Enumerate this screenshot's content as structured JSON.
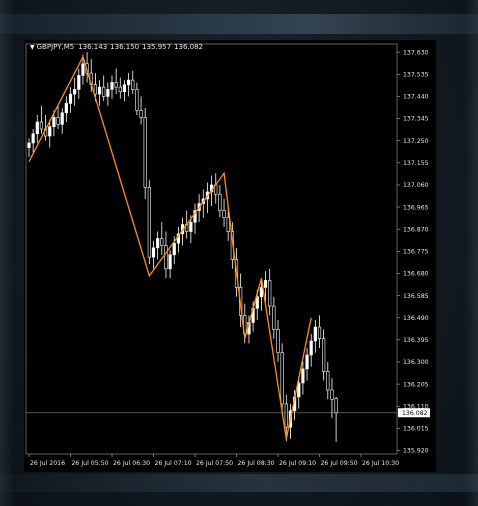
{
  "chart_header": {
    "symbol": "GBPJPY,M5",
    "open": "136.143",
    "high": "136.150",
    "low": "135.957",
    "close": "136.082"
  },
  "chart_data": {
    "type": "candlestick",
    "symbol": "GBPJPY",
    "timeframe": "M5",
    "ylim": [
      135.905,
      137.665
    ],
    "price_axis_labels": [
      "137.630",
      "137.535",
      "137.440",
      "137.345",
      "137.250",
      "137.155",
      "137.060",
      "136.965",
      "136.870",
      "136.775",
      "136.680",
      "136.585",
      "136.490",
      "136.395",
      "136.300",
      "136.205",
      "136.110",
      "136.015",
      "135.920"
    ],
    "current_price_label": "136.082",
    "current_price": 136.082,
    "time_axis_labels": [
      "26 Jul 2016",
      "26 Jul 05:50",
      "26 Jul 06:30",
      "26 Jul 07:10",
      "26 Jul 07:50",
      "26 Jul 08:30",
      "26 Jul 09:10",
      "26 Jul 09:50",
      "26 Jul 10:30"
    ],
    "candle_count": 89,
    "candles": [
      [
        137.22,
        137.26,
        137.18,
        137.24
      ],
      [
        137.24,
        137.3,
        137.2,
        137.28
      ],
      [
        137.28,
        137.36,
        137.24,
        137.33
      ],
      [
        137.33,
        137.4,
        137.28,
        137.3
      ],
      [
        137.3,
        137.36,
        137.25,
        137.27
      ],
      [
        137.27,
        137.34,
        137.22,
        137.31
      ],
      [
        137.31,
        137.38,
        137.27,
        137.35
      ],
      [
        137.35,
        137.4,
        137.3,
        137.32
      ],
      [
        137.32,
        137.39,
        137.28,
        137.37
      ],
      [
        137.37,
        137.44,
        137.33,
        137.41
      ],
      [
        137.41,
        137.48,
        137.37,
        137.45
      ],
      [
        137.45,
        137.52,
        137.4,
        137.47
      ],
      [
        137.47,
        137.56,
        137.43,
        137.53
      ],
      [
        137.53,
        137.62,
        137.49,
        137.58
      ],
      [
        137.58,
        137.63,
        137.5,
        137.54
      ],
      [
        137.54,
        137.6,
        137.46,
        137.49
      ],
      [
        137.49,
        137.54,
        137.42,
        137.45
      ],
      [
        137.45,
        137.51,
        137.4,
        137.48
      ],
      [
        137.48,
        137.53,
        137.42,
        137.44
      ],
      [
        137.44,
        137.5,
        137.4,
        137.47
      ],
      [
        137.47,
        137.53,
        137.43,
        137.5
      ],
      [
        137.5,
        137.56,
        137.45,
        137.48
      ],
      [
        137.48,
        137.52,
        137.43,
        137.46
      ],
      [
        137.46,
        137.51,
        137.42,
        137.49
      ],
      [
        137.49,
        137.54,
        137.44,
        137.51
      ],
      [
        137.51,
        137.55,
        137.45,
        137.47
      ],
      [
        137.47,
        137.5,
        137.36,
        137.38
      ],
      [
        137.38,
        137.44,
        137.32,
        137.35
      ],
      [
        137.35,
        137.39,
        137.0,
        137.05
      ],
      [
        137.05,
        137.08,
        136.72,
        136.75
      ],
      [
        136.75,
        136.82,
        136.7,
        136.79
      ],
      [
        136.79,
        136.86,
        136.74,
        136.83
      ],
      [
        136.83,
        136.9,
        136.76,
        136.8
      ],
      [
        136.8,
        136.86,
        136.66,
        136.7
      ],
      [
        136.7,
        136.78,
        136.66,
        136.76
      ],
      [
        136.76,
        136.84,
        136.72,
        136.81
      ],
      [
        136.81,
        136.88,
        136.77,
        136.85
      ],
      [
        136.85,
        136.92,
        136.8,
        136.89
      ],
      [
        136.89,
        136.95,
        136.83,
        136.86
      ],
      [
        136.86,
        136.93,
        136.81,
        136.9
      ],
      [
        136.9,
        136.98,
        136.85,
        136.95
      ],
      [
        136.95,
        137.02,
        136.9,
        136.98
      ],
      [
        136.98,
        137.04,
        136.92,
        137.0
      ],
      [
        137.0,
        137.07,
        136.94,
        137.03
      ],
      [
        137.03,
        137.1,
        136.97,
        137.06
      ],
      [
        137.06,
        137.11,
        136.98,
        137.02
      ],
      [
        137.02,
        137.06,
        136.92,
        136.95
      ],
      [
        136.95,
        137.0,
        136.88,
        136.92
      ],
      [
        136.92,
        136.97,
        136.82,
        136.86
      ],
      [
        136.86,
        136.9,
        136.7,
        136.74
      ],
      [
        136.74,
        136.79,
        136.58,
        136.62
      ],
      [
        136.62,
        136.68,
        136.45,
        136.5
      ],
      [
        136.5,
        136.55,
        136.38,
        136.42
      ],
      [
        136.42,
        136.5,
        136.38,
        136.47
      ],
      [
        136.47,
        136.56,
        136.43,
        136.53
      ],
      [
        136.53,
        136.61,
        136.48,
        136.58
      ],
      [
        136.58,
        136.66,
        136.52,
        136.62
      ],
      [
        136.62,
        136.69,
        136.56,
        136.65
      ],
      [
        136.65,
        136.7,
        136.5,
        136.54
      ],
      [
        136.54,
        136.58,
        136.4,
        136.44
      ],
      [
        136.44,
        136.48,
        136.3,
        136.34
      ],
      [
        136.34,
        136.38,
        136.08,
        136.12
      ],
      [
        136.12,
        136.16,
        135.96,
        136.02
      ],
      [
        136.02,
        136.12,
        135.97,
        136.09
      ],
      [
        136.09,
        136.18,
        136.05,
        136.15
      ],
      [
        136.15,
        136.24,
        136.1,
        136.21
      ],
      [
        136.21,
        136.3,
        136.16,
        136.27
      ],
      [
        136.27,
        136.36,
        136.22,
        136.33
      ],
      [
        136.33,
        136.42,
        136.28,
        136.39
      ],
      [
        136.39,
        136.48,
        136.34,
        136.45
      ],
      [
        136.45,
        136.5,
        136.36,
        136.4
      ],
      [
        136.4,
        136.44,
        136.22,
        136.26
      ],
      [
        136.26,
        136.3,
        136.14,
        136.18
      ],
      [
        136.18,
        136.23,
        136.06,
        136.14
      ],
      [
        136.143,
        136.15,
        135.957,
        136.082
      ]
    ],
    "zigzag_color": "#ff8c1a",
    "zigzag_points": [
      [
        0,
        137.16
      ],
      [
        13,
        137.61
      ],
      [
        29,
        136.67
      ],
      [
        47,
        137.11
      ],
      [
        52,
        136.4
      ],
      [
        56,
        136.66
      ],
      [
        62,
        135.97
      ],
      [
        68,
        136.49
      ]
    ],
    "colors": {
      "background": "#000000",
      "grid": "#4a4a4a",
      "candle_up_fill": "#ffffff",
      "candle_down_fill": "#000000",
      "candle_outline": "#ffffff",
      "axis_text": "#e6e6e6",
      "current_price_line": "#808080",
      "current_price_box": "#ffffff"
    }
  }
}
